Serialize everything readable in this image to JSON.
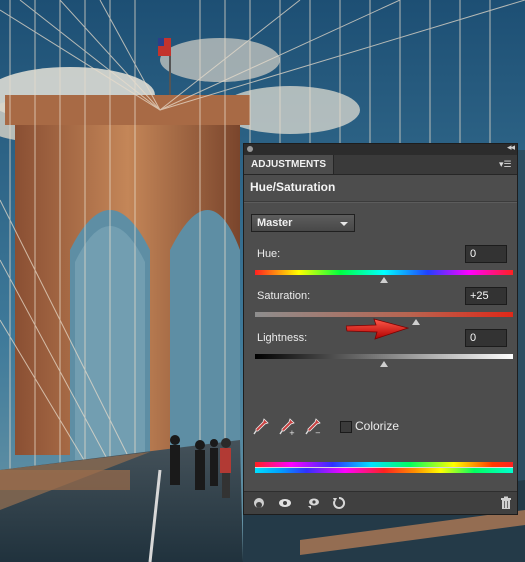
{
  "panel": {
    "tab_label": "ADJUSTMENTS",
    "heading": "Hue/Saturation",
    "preset": "Master",
    "colorize_label": "Colorize",
    "colorize_checked": false,
    "sliders": [
      {
        "label": "Hue:",
        "value": "0",
        "position": 0.5
      },
      {
        "label": "Saturation:",
        "value": "+25",
        "position": 0.625
      },
      {
        "label": "Lightness:",
        "value": "0",
        "position": 0.5
      }
    ]
  },
  "icons": {
    "titlebar_close": "close-dot-icon",
    "titlebar_collapse": "double-chevron-icon",
    "panel_menu": "panel-menu-icon",
    "droppers": [
      "eyedropper-icon",
      "eyedropper-plus-icon",
      "eyedropper-minus-icon"
    ],
    "bottom": [
      "clip-to-layer-icon",
      "visibility-eye-icon",
      "previous-state-icon",
      "reset-icon",
      "delete-trash-icon"
    ],
    "annotation": "red-arrow-icon"
  },
  "colors": {
    "panel_bg": "#4d4d4d",
    "arrow": "#e01010",
    "saturation_track": "#d83a2a"
  }
}
